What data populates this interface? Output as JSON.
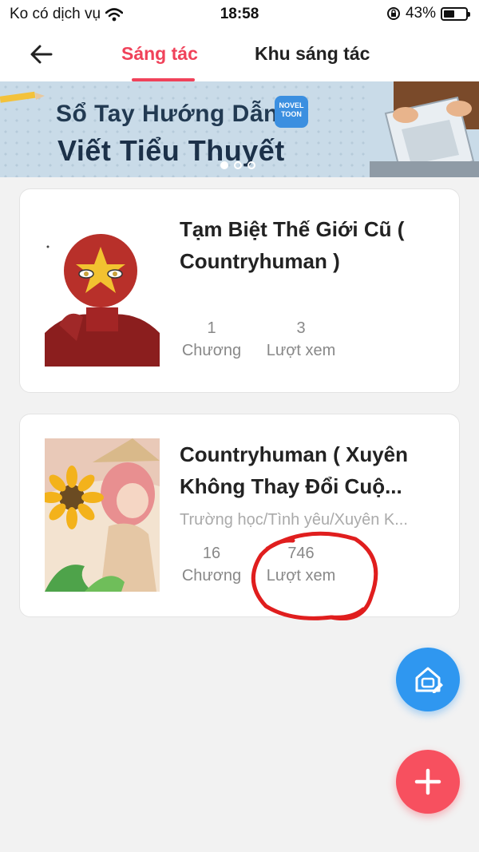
{
  "status_bar": {
    "carrier": "Ko có dịch vụ",
    "time": "18:58",
    "battery": "43%"
  },
  "header": {
    "tabs": [
      {
        "label": "Sáng tác",
        "active": true
      },
      {
        "label": "Khu sáng tác",
        "active": false
      }
    ]
  },
  "banner": {
    "line1": "Sổ Tay Hướng Dẫn",
    "line2": "Viết Tiểu Thuyết",
    "logo_text": "NOVEL TOON",
    "pages": 3,
    "current_page": 1
  },
  "works": [
    {
      "title": "Tạm Biệt Thế Giới Cũ ( Countryhuman )",
      "genre": "",
      "chapters": "1",
      "chapters_label": "Chương",
      "views": "3",
      "views_label": "Lượt xem"
    },
    {
      "title": "Countryhuman ( Xuyên Không Thay Đổi Cuộ...",
      "genre": "Trường học/Tình yêu/Xuyên K...",
      "chapters": "16",
      "chapters_label": "Chương",
      "views": "746",
      "views_label": "Lượt xem"
    }
  ],
  "colors": {
    "accent": "#f0425a",
    "fab_home": "#2f97f0",
    "fab_add": "#f7505f",
    "annotation": "#e01e1e"
  },
  "icons": [
    "back-arrow-icon",
    "wifi-icon",
    "lock-rotation-icon",
    "battery-icon",
    "creator-home-icon",
    "plus-icon"
  ]
}
